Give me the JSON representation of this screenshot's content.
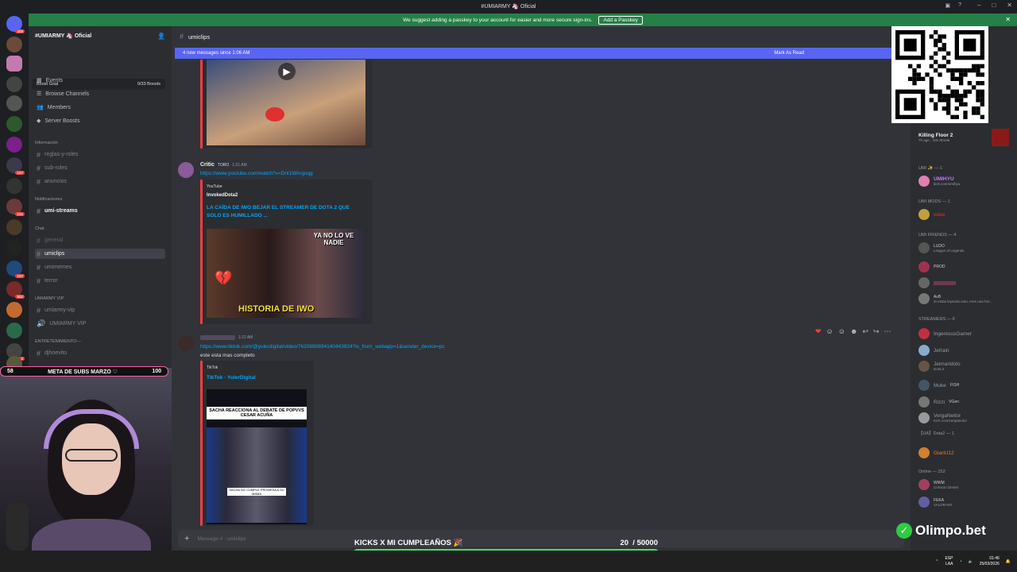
{
  "window": {
    "title": "#UMIARMY 🦄 Oficial"
  },
  "notice": {
    "text": "We suggest adding a passkey to your account for easier and more secure sign-ins.",
    "button": "Add a Passkey"
  },
  "rail_badges": [
    "409",
    "147",
    "121",
    "167",
    "802",
    "2",
    "11",
    "58"
  ],
  "sidebar": {
    "guild_name": "#UMIARMY 🦄 Oficial",
    "boost_goal": "Boost Goal",
    "boost_count": "0/33 Boosts",
    "nav": [
      "Events",
      "Browse Channels",
      "Members",
      "Server Boosts"
    ],
    "cat_info": "Información",
    "ch_reglas": "reglas-y-roles",
    "ch_subroles": "sub-roles",
    "ch_anuncios": "anuncios",
    "cat_notif": "Notificaciones",
    "ch_umistreams": "umi-streams",
    "cat_chat": "Chat",
    "ch_general": "general",
    "ch_umiclips": "umiclips",
    "ch_umimemes": "umimemes",
    "ch_terror": "terror",
    "cat_vip": "UMIARMY VIP",
    "ch_umiarmyvip": "umiarmy-vip",
    "ch_umiarmyvip_voice": "UMIARMY VIP",
    "cat_ent": "ENTRETENIMIENTO---",
    "ch_djhoevito": "djhoevito"
  },
  "main": {
    "channel": "umiclips",
    "new_messages": "4 new messages since 1:06 AM",
    "mark_read": "Mark As Read",
    "msg1": {
      "author": "Critic",
      "tag": "TORO",
      "time": "1:21 AM",
      "link": "https://www.youtube.com/watch?v=Dnl1WArgsqg",
      "provider": "YouTube",
      "channel": "InvokedDota2",
      "title": "LA CAÍDA DE IWO BEJAR EL STREAMER DE DOTA 2 QUE SOLO ES HUMILLADO ...",
      "thumb_text1": "YA NO LO VE NADIE",
      "thumb_text2": "HISTORIA DE IWO"
    },
    "msg2": {
      "time": "1:22 AM",
      "link": "https://www.tiktok.com/@yulerdigital/video/7620890894140443924?is_from_webapp=1&sender_device=pc",
      "text": "este esta mas completo",
      "provider": "TikTok",
      "title": "TikTok · YulerDigital",
      "thumb_caption": "SACHA REACCIONA AL DEBATE DE POPVVS CESAR ACUÑA",
      "thumb_sub": "SACHA NO CUMPLE PROMESA A SU MAMA"
    },
    "composer_placeholder": "Message # · umiclips"
  },
  "members": {
    "game_title": "Killing Floor 2",
    "game_sub": "7h ago · 43s Streak",
    "cat_umi": "UMI ✨ — 1",
    "umihyu": "UMIHYU",
    "umihyu_sub": "kick.com/umihyu",
    "cat_mods": "UMI MODS — 1",
    "mod1": "wlaw",
    "cat_friends": "UMI FRIENDS — 4",
    "friend1_tag": "LUDO",
    "friend1_sub": "League of Legends",
    "friend2_tag": "PROD",
    "friend4_tag": "AvB",
    "friend4_sub": "Si estás leyendo esto, eres una her...",
    "cat_streamers": "STREAMERS — 6",
    "s1": "IngeniousGamer",
    "s2": "Jefrain",
    "s3": "Jeimaridoto",
    "s3_sub": "Dota 2",
    "s4": "Muke",
    "s4_tag": "FISH",
    "s5": "Rizzi",
    "s5_tag": "VGen",
    "s6": "VergaNeitor",
    "s6_sub": "Kick.com/verganeitor",
    "cat_ua": "【UA】Dota2 — 1",
    "ua1": "GianU12",
    "cat_online": "Online — 252",
    "on1_tag": "WWM",
    "on1_sub": "Crimson Desert",
    "on2_tag": "FEKA",
    "on2_sub": "VALORANT"
  },
  "overlay": {
    "goal_left": "58",
    "goal_label": "META DE SUBS MARZO ♡",
    "goal_right": "100",
    "kicks_label": "KICKS X MI CUMPLEAÑOS 🎉",
    "kicks_count": "20",
    "kicks_total": "/ 50000",
    "kicks_progress": 0.0004,
    "sponsor": "Olimpo.bet"
  },
  "taskbar": {
    "lang": "ESP",
    "lang2": "LAA",
    "time": "01:46",
    "date": "25/03/2026"
  }
}
